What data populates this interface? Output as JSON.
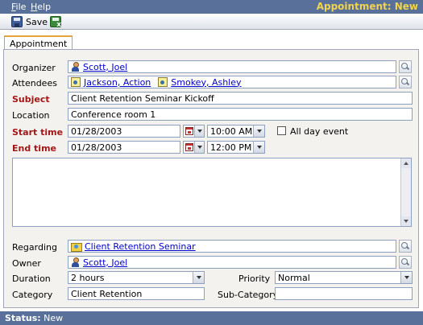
{
  "menu": {
    "file": "File",
    "file_key": "F",
    "file_rest": "ile",
    "help": "Help",
    "help_key": "H",
    "help_rest": "elp"
  },
  "window_title": "Appointment: New",
  "toolbar": {
    "save_label": "Save"
  },
  "tabs": [
    {
      "label": "Appointment"
    }
  ],
  "form": {
    "organizer": {
      "label": "Organizer",
      "values": [
        "Scott, Joel"
      ]
    },
    "attendees": {
      "label": "Attendees",
      "values": [
        "Jackson, Action",
        "Smokey, Ashley"
      ]
    },
    "subject": {
      "label": "Subject",
      "value": "Client Retention Seminar Kickoff"
    },
    "location": {
      "label": "Location",
      "value": "Conference room 1"
    },
    "start_time": {
      "label": "Start time",
      "date": "01/28/2003",
      "time": "10:00 AM"
    },
    "all_day": {
      "label": "All day event",
      "checked": false
    },
    "end_time": {
      "label": "End time",
      "date": "01/28/2003",
      "time": "12:00 PM"
    },
    "description": {
      "value": ""
    },
    "regarding": {
      "label": "Regarding",
      "value": "Client Retention Seminar"
    },
    "owner": {
      "label": "Owner",
      "value": "Scott, Joel"
    },
    "duration": {
      "label": "Duration",
      "value": "2 hours"
    },
    "priority": {
      "label": "Priority",
      "value": "Normal"
    },
    "category": {
      "label": "Category",
      "value": "Client Retention"
    },
    "subcategory": {
      "label": "Sub-Category",
      "value": ""
    }
  },
  "status": {
    "label": "Status:",
    "value": "New"
  },
  "colors": {
    "bar": "#59709a",
    "title": "#f1d44d",
    "required_label": "#a01818",
    "link": "#0000cc"
  },
  "icons": [
    "save-icon",
    "save-and-close-icon",
    "person-icon",
    "contact-icon",
    "campaign-icon",
    "lookup-icon",
    "calendar-icon",
    "chevron-down-icon"
  ]
}
